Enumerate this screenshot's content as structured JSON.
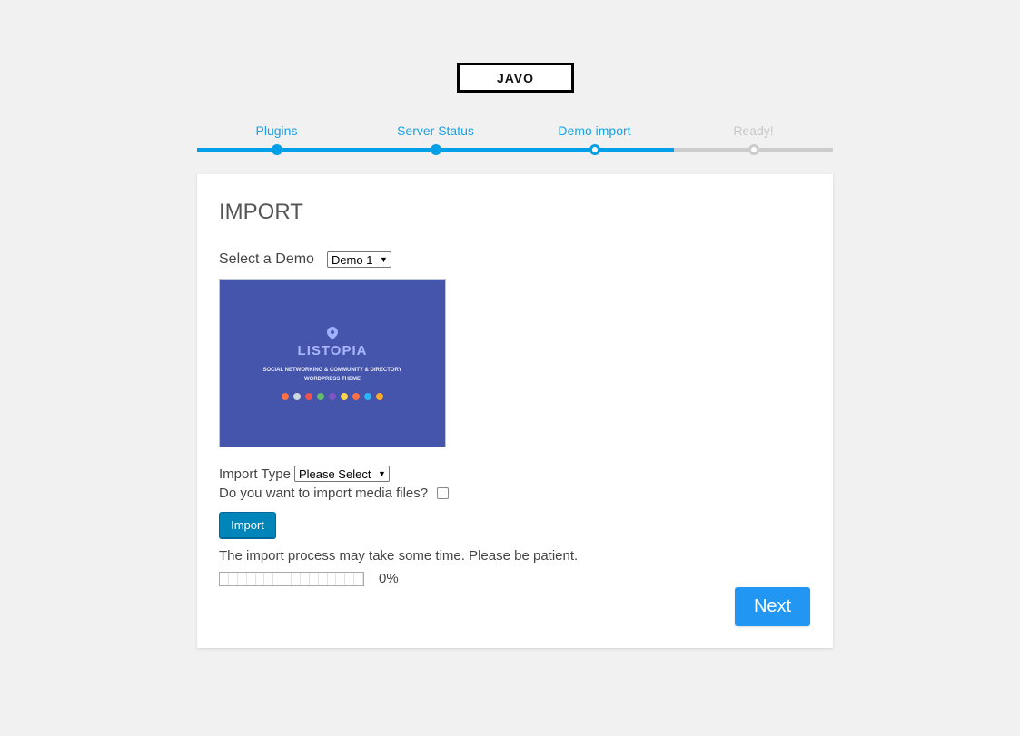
{
  "logo": {
    "text": "JAVO"
  },
  "steps": [
    {
      "label": "Plugins",
      "state": "done"
    },
    {
      "label": "Server Status",
      "state": "done"
    },
    {
      "label": "Demo import",
      "state": "current"
    },
    {
      "label": "Ready!",
      "state": "todo"
    }
  ],
  "colors": {
    "accent": "#00a0e9",
    "button": "#0085ba",
    "next": "#2196f3",
    "pending": "#cccccc",
    "preview_bg": "#4555ab"
  },
  "import": {
    "title": "IMPORT",
    "demo_label": "Select a Demo",
    "demo_selected": "Demo 1",
    "preview": {
      "brand": "LISTOPIA",
      "tagline_1": "SOCIAL NETWORKING & COMMUNITY & DIRECTORY",
      "tagline_2": "WORDPRESS THEME"
    },
    "type_label": "Import Type",
    "type_selected": "Please Select",
    "media_label": "Do you want to import media files?",
    "media_checked": false,
    "import_button": "Import",
    "note": "The import process may take some time. Please be patient.",
    "progress": 0,
    "progress_text": "0%"
  },
  "next_button": "Next"
}
